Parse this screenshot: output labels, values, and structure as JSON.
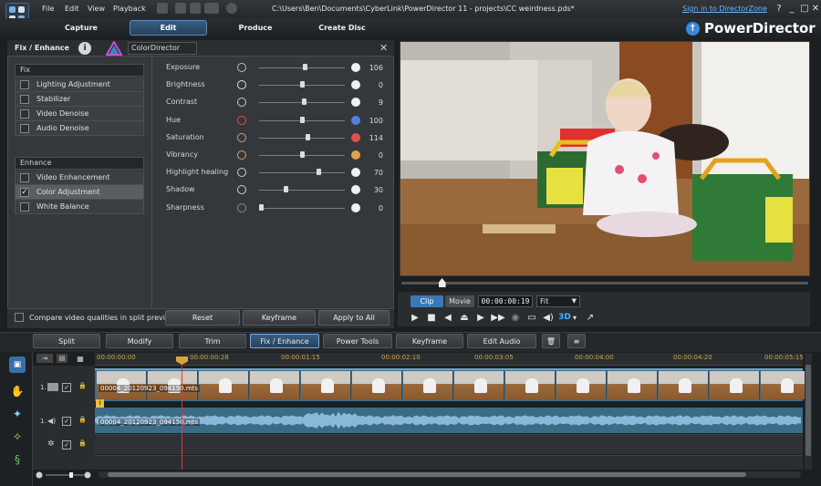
{
  "app": {
    "title_path": "C:\\Users\\Ben\\Documents\\CyberLink\\PowerDirector 11 - projects\\CC weirdness.pds*",
    "menu": [
      "File",
      "Edit",
      "View",
      "Playback"
    ],
    "signin_link": "Sign in to DirectorZone",
    "brand": "PowerDirector",
    "window_controls": {
      "help": "?",
      "minimize": "_",
      "maximize": "□",
      "close": "✕"
    }
  },
  "tabs": [
    {
      "label": "Capture",
      "active": false
    },
    {
      "label": "Edit",
      "active": true
    },
    {
      "label": "Produce",
      "active": false
    },
    {
      "label": "Create Disc",
      "active": false
    }
  ],
  "panel": {
    "title": "Fix / Enhance",
    "info": "i",
    "color_director": "ColorDirector",
    "close": "✕",
    "fix_header": "Fix",
    "fix_items": [
      {
        "label": "Lighting Adjustment",
        "checked": false
      },
      {
        "label": "Stabilizer",
        "checked": false
      },
      {
        "label": "Video Denoise",
        "checked": false
      },
      {
        "label": "Audio Denoise",
        "checked": false
      }
    ],
    "enhance_header": "Enhance",
    "enhance_items": [
      {
        "label": "Video Enhancement",
        "checked": false
      },
      {
        "label": "Color Adjustment",
        "checked": true,
        "check_mark": "✓"
      },
      {
        "label": "White Balance",
        "checked": false
      }
    ],
    "sliders": [
      {
        "label": "Exposure",
        "value": "106",
        "level": 0.53
      },
      {
        "label": "Brightness",
        "value": "0",
        "level": 0.5
      },
      {
        "label": "Contrast",
        "value": "9",
        "level": 0.52
      },
      {
        "label": "Hue",
        "value": "100",
        "level": 0.5
      },
      {
        "label": "Saturation",
        "value": "114",
        "level": 0.57
      },
      {
        "label": "Vibrancy",
        "value": "0",
        "level": 0.5
      },
      {
        "label": "Highlight healing",
        "value": "70",
        "level": 0.7
      },
      {
        "label": "Shadow",
        "value": "30",
        "level": 0.3
      },
      {
        "label": "Sharpness",
        "value": "0",
        "level": 0.0
      }
    ],
    "compare_label": "Compare video qualities in split preview",
    "buttons": {
      "reset": "Reset",
      "keyframe": "Keyframe",
      "apply_all": "Apply to All"
    }
  },
  "preview": {
    "clip": "Clip",
    "movie": "Movie",
    "timecode": "00:00:00:19",
    "fit": "Fit",
    "playhead_position": 0.1,
    "controls": {
      "play": "▶",
      "stop": "■",
      "prev": "◀",
      "snapshot": "⏏",
      "next": "▶",
      "fast_forward": "▶▶",
      "camera": "◉",
      "screen": "▭",
      "volume": "◀)",
      "three_d": "3D",
      "three_d_arrow": "▾",
      "undock": "↗"
    }
  },
  "rooms": [
    "Split",
    "Modify",
    "Trim",
    "Fix / Enhance",
    "Power Tools",
    "Keyframe",
    "Edit Audio"
  ],
  "room_icons": {
    "delete": "🗑",
    "more": "≡"
  },
  "timeline": {
    "ruler": [
      "00:00:00:00",
      "00:00:00:28",
      "00:00:01:15",
      "00:00:02:10",
      "00:00:03:05",
      "00:00:04:00",
      "00:00:04:20",
      "00:00:05:15"
    ],
    "video_track_num": "1.",
    "audio_track_num": "1.",
    "video_clip": "00004_20120923_094150.mts",
    "audio_clip": "00004_20120923_094150.mts",
    "clip_marker": "i",
    "track_checkbox": "✓",
    "lock_icon": "🔒",
    "fx_icon": "✲"
  }
}
